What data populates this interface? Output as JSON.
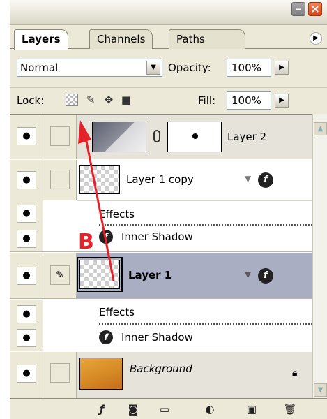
{
  "tabs": [
    {
      "label": "Layers"
    },
    {
      "label": "Channels"
    },
    {
      "label": "Paths"
    }
  ],
  "blend_mode": "Normal",
  "opacity": {
    "label": "Opacity:",
    "value": "100%"
  },
  "lock": {
    "label": "Lock:"
  },
  "fill": {
    "label": "Fill:",
    "value": "100%"
  },
  "layers": [
    {
      "name": "Layer 2"
    },
    {
      "name": "Layer 1 copy",
      "effects_label": "Effects",
      "effect": "Inner Shadow"
    },
    {
      "name": "Layer 1",
      "effects_label": "Effects",
      "effect": "Inner Shadow"
    },
    {
      "name": "Background"
    }
  ],
  "annotation": {
    "label": "B",
    "color": "#e5212a"
  },
  "colors": {
    "selected_row": "#a9aec2",
    "panel_bg": "#ece9d8"
  }
}
